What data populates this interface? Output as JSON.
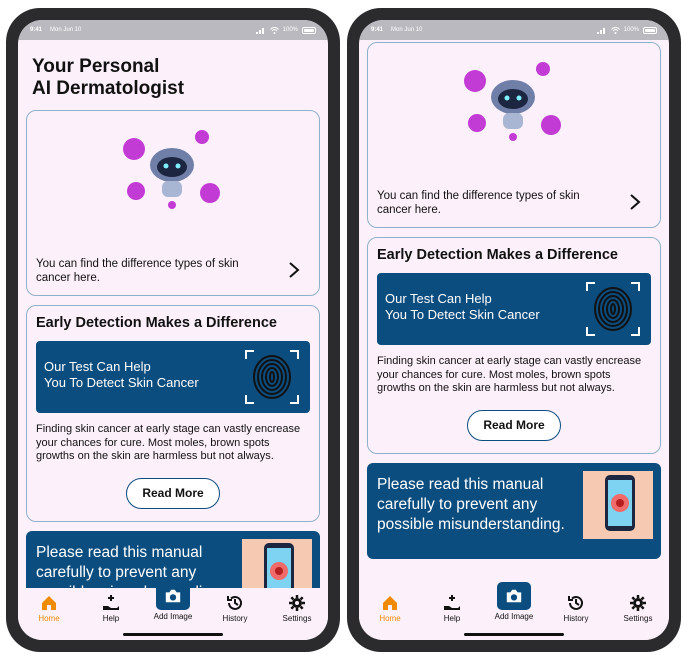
{
  "status": {
    "time": "9:41",
    "date": "Mon Jun 10",
    "battery": "100%"
  },
  "home": {
    "title_line1": "Your Personal",
    "title_line2": "AI Dermatologist"
  },
  "promo": {
    "text": "You can find the difference types of skin cancer here."
  },
  "detection": {
    "title": "Early Detection Makes a Difference",
    "banner_line1": "Our Test Can Help",
    "banner_line2": "You To Detect Skin Cancer",
    "body": "Finding skin cancer at early stage can vastly encrease your chances for cure. Most moles, brown spots growths on the skin are harmless but not always.",
    "read_more": "Read More"
  },
  "manual": {
    "text": "Please read this manual carefully to prevent any possible misunderstanding."
  },
  "tabs": [
    {
      "label": "Home",
      "icon": "home-icon"
    },
    {
      "label": "Help",
      "icon": "help-icon"
    },
    {
      "label": "Add Image",
      "icon": "camera-icon"
    },
    {
      "label": "History",
      "icon": "history-icon"
    },
    {
      "label": "Settings",
      "icon": "gear-icon"
    }
  ],
  "colors": {
    "accent": "#f08a00",
    "brand": "#0c4d7f",
    "background": "#fcf1fb",
    "border": "#8fb1c9"
  }
}
